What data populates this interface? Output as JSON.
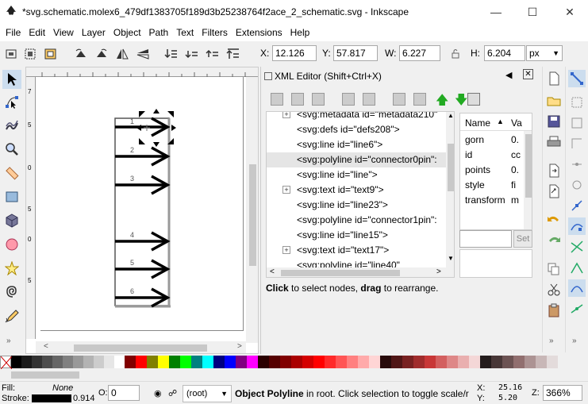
{
  "window": {
    "title": "*svg.schematic.molex6_479df1383705f189d3b25238764f2ace_2_schematic.svg - Inkscape",
    "minimize_icon": "minimize-icon",
    "maximize_icon": "maximize-icon",
    "close_icon": "close-icon"
  },
  "menu": [
    "File",
    "Edit",
    "View",
    "Layer",
    "Object",
    "Path",
    "Text",
    "Filters",
    "Extensions",
    "Help"
  ],
  "toolcontrols": {
    "x_label": "X:",
    "x_value": "12.126",
    "y_label": "Y:",
    "y_value": "57.817",
    "w_label": "W:",
    "w_value": "6.227",
    "h_label": "H:",
    "h_value": "6.204",
    "unit": "px"
  },
  "canvas": {
    "pin_labels": [
      "1",
      "2",
      "3",
      "4",
      "5",
      "6"
    ],
    "ruler_left_marks": [
      "7",
      "5",
      "0",
      "5",
      "0",
      "5"
    ]
  },
  "xml_editor": {
    "title": "XML Editor (Shift+Ctrl+X)",
    "nodes": [
      {
        "text": "<svg:metadata id=\"metadata210\"",
        "expander": true
      },
      {
        "text": "<svg:defs id=\"defs208\">",
        "expander": false
      },
      {
        "text": "<svg:line id=\"line6\">",
        "expander": false
      },
      {
        "text": "<svg:polyline id=\"connector0pin\":",
        "expander": false,
        "selected": true
      },
      {
        "text": "<svg:line id=\"line\">",
        "expander": false
      },
      {
        "text": "<svg:text id=\"text9\">",
        "expander": true
      },
      {
        "text": "<svg:line id=\"line23\">",
        "expander": false
      },
      {
        "text": "<svg:polyline id=\"connector1pin\":",
        "expander": false
      },
      {
        "text": "<svg:line id=\"line15\">",
        "expander": false
      },
      {
        "text": "<svg:text id=\"text17\">",
        "expander": true
      },
      {
        "text": "<svg:polyline id=\"line40\"",
        "expander": false
      }
    ],
    "attr_headers": {
      "name": "Name",
      "value": "Va"
    },
    "attributes": [
      {
        "name": "gorn",
        "value": "0."
      },
      {
        "name": "id",
        "value": "cc"
      },
      {
        "name": "points",
        "value": "0."
      },
      {
        "name": "style",
        "value": "fi"
      },
      {
        "name": "transform",
        "value": "m"
      }
    ],
    "set_button": "Set",
    "hint_bold1": "Click",
    "hint_text1": " to select nodes, ",
    "hint_bold2": "drag",
    "hint_text2": " to rearrange."
  },
  "palette_colors": [
    "#000000",
    "#1a1a1a",
    "#333333",
    "#4d4d4d",
    "#666666",
    "#808080",
    "#999999",
    "#b3b3b3",
    "#cccccc",
    "#e6e6e6",
    "#ffffff",
    "#800000",
    "#ff0000",
    "#808000",
    "#ffff00",
    "#008000",
    "#00ff00",
    "#008080",
    "#00ffff",
    "#000080",
    "#0000ff",
    "#800080",
    "#ff00ff",
    "#2b0000",
    "#550000",
    "#800000",
    "#aa0000",
    "#d40000",
    "#ff0000",
    "#ff2a2a",
    "#ff5555",
    "#ff8080",
    "#ffaaaa",
    "#ffd5d5",
    "#280b0b",
    "#501616",
    "#782121",
    "#a02c2c",
    "#c83737",
    "#d35f5f",
    "#de8787",
    "#e9afaf",
    "#f4d7d7",
    "#241c1c",
    "#483737",
    "#6c5353",
    "#916f6f",
    "#ac9393",
    "#c8b7b7",
    "#e3dbdb"
  ],
  "status": {
    "fill_label": "Fill:",
    "fill_value": "None",
    "stroke_label": "Stroke:",
    "stroke_width": "0.914",
    "opacity_label": "O:",
    "opacity_value": "0",
    "layer": "(root)",
    "message_bold": "Object Polyline",
    "message": " in root. Click selection to toggle scale/r",
    "x_label": "X:",
    "x_value": "25.16",
    "y_label": "Y:",
    "y_value": "5.20",
    "zoom_label": "Z:",
    "zoom_value": "366%"
  }
}
